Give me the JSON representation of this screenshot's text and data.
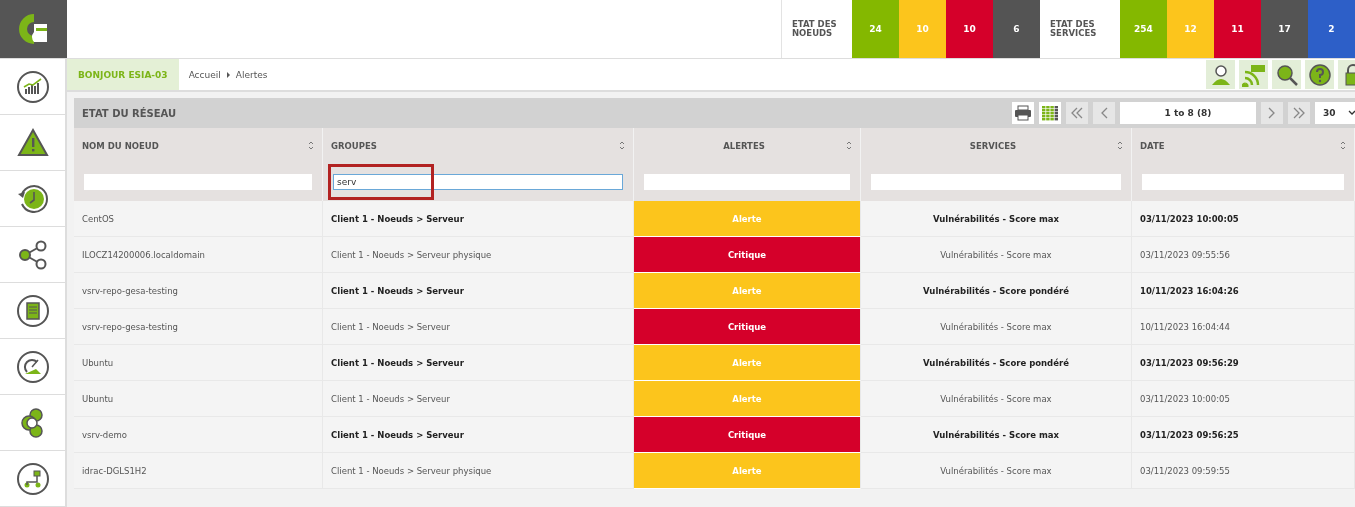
{
  "status": {
    "nodes": {
      "label": "ETAT DES NOEUDS",
      "counts": [
        {
          "value": "24",
          "color": "#84b800"
        },
        {
          "value": "10",
          "color": "#fcc51c"
        },
        {
          "value": "10",
          "color": "#d5002a"
        },
        {
          "value": "6",
          "color": "#545454"
        }
      ]
    },
    "services": {
      "label": "ETAT DES SERVICES",
      "counts": [
        {
          "value": "254",
          "color": "#84b800"
        },
        {
          "value": "12",
          "color": "#fcc51c"
        },
        {
          "value": "11",
          "color": "#d5002a"
        },
        {
          "value": "17",
          "color": "#545454"
        },
        {
          "value": "2",
          "color": "#2d5fc8"
        }
      ]
    }
  },
  "greeting": "BONJOUR ESIA-03",
  "breadcrumb": [
    "Accueil",
    "Alertes"
  ],
  "panel": {
    "title": "ETAT DU RÉSEAU",
    "pager": "1 to 8 (8)",
    "page_size": "30"
  },
  "table": {
    "columns": [
      {
        "label": "NOM DU NOEUD"
      },
      {
        "label": "GROUPES",
        "filter": "serv",
        "highlighted": true
      },
      {
        "label": "ALERTES"
      },
      {
        "label": "SERVICES"
      },
      {
        "label": "DATE"
      }
    ],
    "rows": [
      {
        "node": "CentOS",
        "group": "Client 1 - Noeuds > Serveur",
        "alert": "Alerte",
        "kind": "warning",
        "service": "Vulnérabilités - Score max",
        "date": "03/11/2023 10:00:05",
        "unread": true
      },
      {
        "node": "ILOCZ14200006.localdomain",
        "group": "Client 1 - Noeuds > Serveur physique",
        "alert": "Critique",
        "kind": "critical",
        "service": "Vulnérabilités - Score max",
        "date": "03/11/2023 09:55:56",
        "unread": false
      },
      {
        "node": "vsrv-repo-gesa-testing",
        "group": "Client 1 - Noeuds > Serveur",
        "alert": "Alerte",
        "kind": "warning",
        "service": "Vulnérabilités - Score pondéré",
        "date": "10/11/2023 16:04:26",
        "unread": true
      },
      {
        "node": "vsrv-repo-gesa-testing",
        "group": "Client 1 - Noeuds > Serveur",
        "alert": "Critique",
        "kind": "critical",
        "service": "Vulnérabilités - Score max",
        "date": "10/11/2023 16:04:44",
        "unread": false
      },
      {
        "node": "Ubuntu",
        "group": "Client 1 - Noeuds > Serveur",
        "alert": "Alerte",
        "kind": "warning",
        "service": "Vulnérabilités - Score pondéré",
        "date": "03/11/2023 09:56:29",
        "unread": true
      },
      {
        "node": "Ubuntu",
        "group": "Client 1 - Noeuds > Serveur",
        "alert": "Alerte",
        "kind": "warning",
        "service": "Vulnérabilités - Score max",
        "date": "03/11/2023 10:00:05",
        "unread": false
      },
      {
        "node": "vsrv-demo",
        "group": "Client 1 - Noeuds > Serveur",
        "alert": "Critique",
        "kind": "critical",
        "service": "Vulnérabilités - Score max",
        "date": "03/11/2023 09:56:25",
        "unread": true
      },
      {
        "node": "idrac-DGLS1H2",
        "group": "Client 1 - Noeuds > Serveur physique",
        "alert": "Alerte",
        "kind": "warning",
        "service": "Vulnérabilités - Score max",
        "date": "03/11/2023 09:59:55",
        "unread": false
      }
    ]
  }
}
